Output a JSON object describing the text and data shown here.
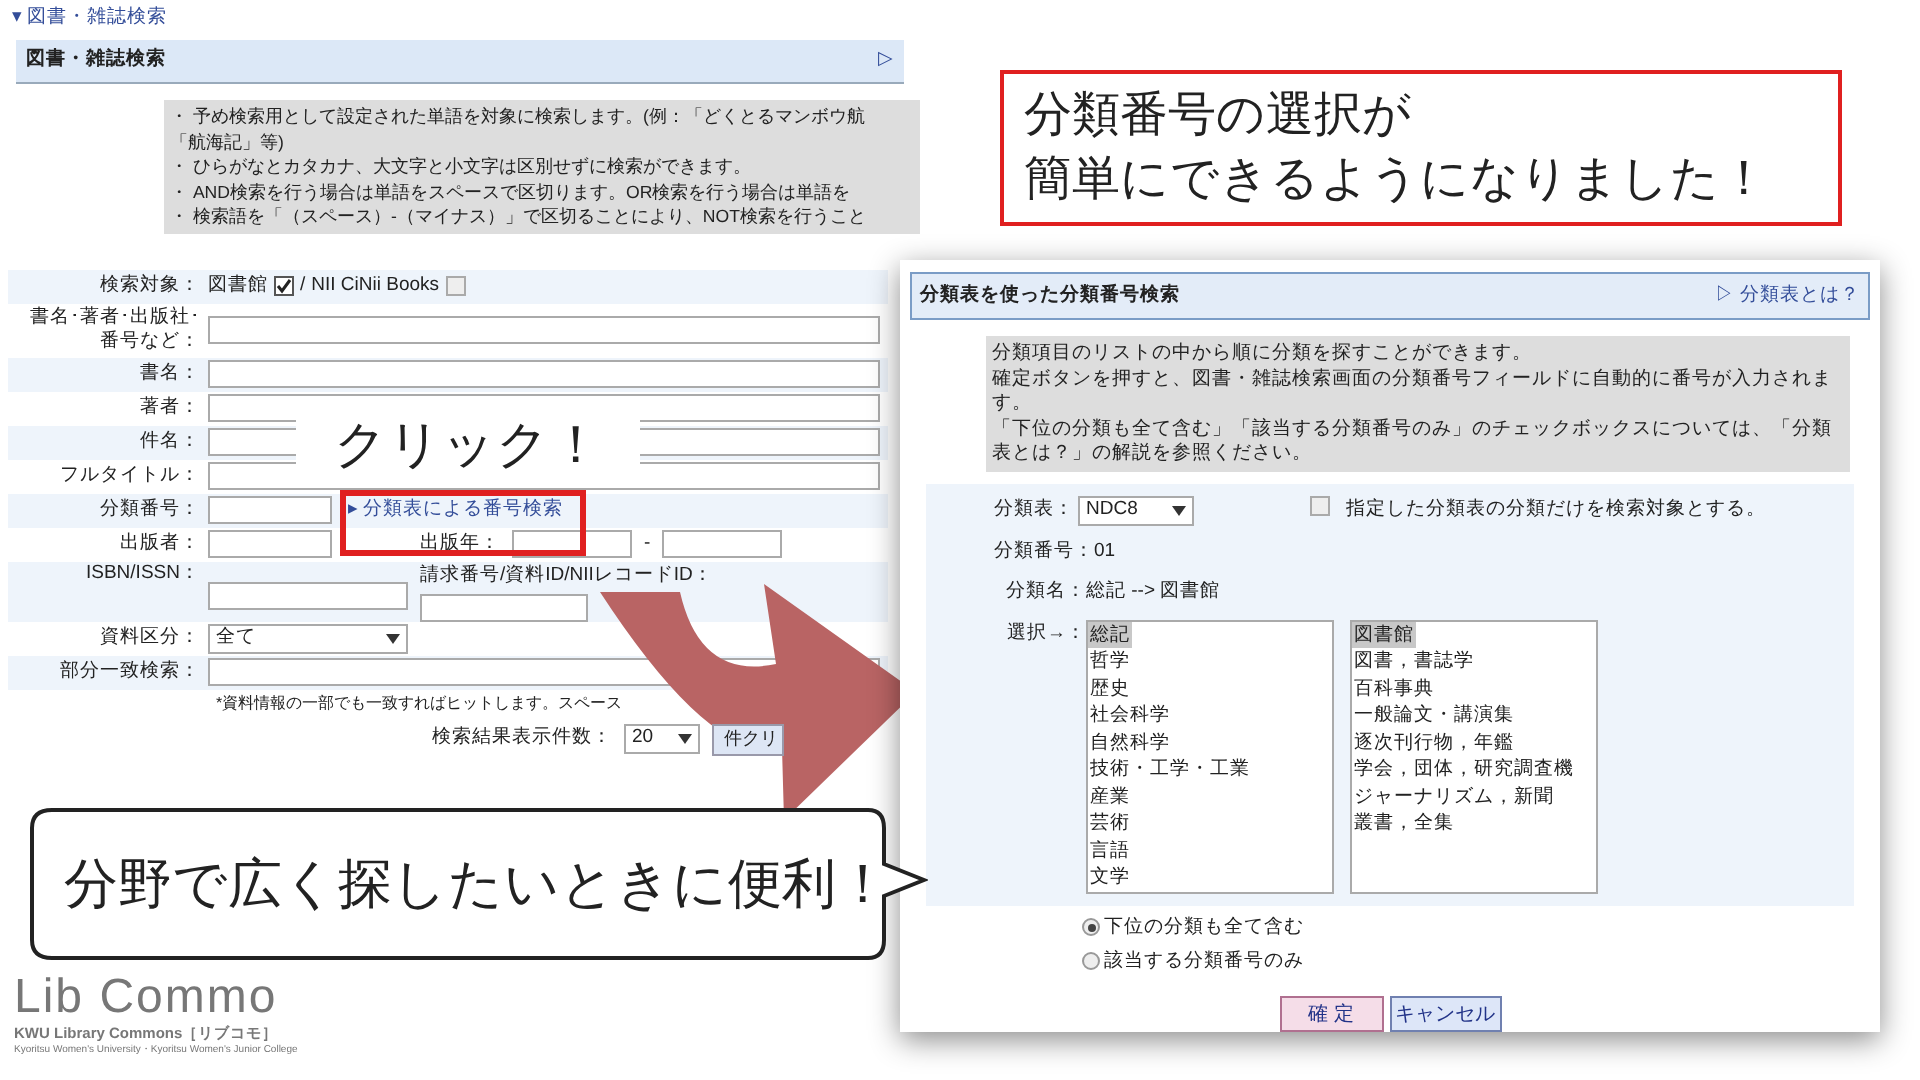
{
  "breadcrumb": "▾ 図書・雑誌検索",
  "search_panel": {
    "title": "図書・雑誌検索",
    "expand_glyph": "▷",
    "notes": [
      "・ 予め検索用として設定された単語を対象に検索します。(例：「どくとるマンボウ航",
      "「航海記」等)",
      "・ ひらがなとカタカナ、大文字と小文字は区別せずに検索ができます。",
      "・ AND検索を行う場合は単語をスペースで区切ります。OR検索を行う場合は単語を",
      "・ 検索語を「（スペース）-（マイナス）」で区切ることにより、NOT検索を行うこと"
    ],
    "target_label": "検索対象：",
    "separator": "/",
    "targets": [
      {
        "label": "図書館",
        "checked": true
      },
      {
        "label": "NII CiNii Books",
        "checked": false
      }
    ],
    "rows": [
      {
        "kind": "text",
        "label_lines": [
          "書名･著者･出版社･",
          "番号など："
        ]
      },
      {
        "kind": "text",
        "label_lines": [
          "書名："
        ]
      },
      {
        "kind": "text",
        "label_lines": [
          "著者："
        ]
      },
      {
        "kind": "text",
        "label_lines": [
          "件名："
        ]
      },
      {
        "kind": "text",
        "label_lines": [
          "フルタイトル："
        ]
      },
      {
        "kind": "class_no",
        "label_lines": [
          "分類番号："
        ],
        "link": "▸ 分類表による番号検索"
      },
      {
        "kind": "publisher",
        "label_lines": [
          "出版者："
        ],
        "year_label": "出版年：",
        "range_sep": "-"
      },
      {
        "kind": "isbn",
        "label_lines": [
          "ISBN/ISSN："
        ],
        "call_label": "請求番号/資料ID/NIIレコードID："
      },
      {
        "kind": "select",
        "label_lines": [
          "資料区分："
        ],
        "value": "全て"
      },
      {
        "kind": "partial",
        "label_lines": [
          "部分一致検索："
        ],
        "note": "*資料情報の一部でも一致すればヒットします。スペース"
      }
    ],
    "count_label": "検索結果表示件数：",
    "count_value": "20",
    "clear_button": "件クリ"
  },
  "callout": {
    "lines": [
      "分類番号の選択が",
      "簡単にできるようになりました！"
    ]
  },
  "click_label": "クリック！",
  "speech_bubble": "分野で広く探したいときに便利！",
  "dialog": {
    "title": "分類表を使った分類番号検索",
    "help_link": "▷ 分類表とは？",
    "notes": [
      "分類項目のリストの中から順に分類を探すことができます。",
      "確定ボタンを押すと、図書・雑誌検索画面の分類番号フィールドに自動的に番号が入力されます。",
      "「下位の分類も全て含む」「該当する分類番号のみ」のチェックボックスについては、「分類表とは？」の解説を参照ください。"
    ],
    "scheme_label": "分類表：",
    "scheme_value": "NDC8",
    "restrict": {
      "label": "指定した分類表の分類だけを検索対象とする。",
      "checked": false
    },
    "number_label": "分類番号：",
    "number_value": "01",
    "name_label": "分類名：",
    "name_value": "総記 --> 図書館",
    "select_label": "選択→：",
    "lists": [
      {
        "items": [
          {
            "label": "総記",
            "selected": true
          },
          {
            "label": "哲学",
            "selected": false
          },
          {
            "label": "歴史",
            "selected": false
          },
          {
            "label": "社会科学",
            "selected": false
          },
          {
            "label": "自然科学",
            "selected": false
          },
          {
            "label": "技術・工学・工業",
            "selected": false
          },
          {
            "label": "産業",
            "selected": false
          },
          {
            "label": "芸術",
            "selected": false
          },
          {
            "label": "言語",
            "selected": false
          },
          {
            "label": "文学",
            "selected": false
          }
        ]
      },
      {
        "items": [
          {
            "label": "図書館",
            "selected": true
          },
          {
            "label": "図書，書誌学",
            "selected": false
          },
          {
            "label": "百科事典",
            "selected": false
          },
          {
            "label": "一般論文・講演集",
            "selected": false
          },
          {
            "label": "逐次刊行物，年鑑",
            "selected": false
          },
          {
            "label": "学会，団体，研究調査機",
            "selected": false
          },
          {
            "label": "ジャーナリズム，新聞",
            "selected": false
          },
          {
            "label": "叢書，全集",
            "selected": false
          }
        ]
      }
    ],
    "scope": [
      {
        "label": "下位の分類も全て含む",
        "selected": true
      },
      {
        "label": "該当する分類番号のみ",
        "selected": false
      }
    ],
    "buttons": [
      {
        "label": "確 定",
        "kind": "primary"
      },
      {
        "label": "キャンセル",
        "kind": "secondary"
      }
    ]
  },
  "logo": {
    "wordmark": "Lib Commo",
    "subtitle": "KWU Library Commons［リブコモ］",
    "tagline": "Kyoritsu Women's University・Kyoritsu Women's Junior College"
  }
}
